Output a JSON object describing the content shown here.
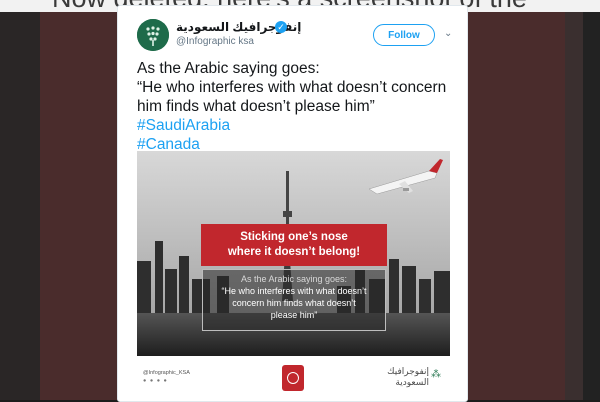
{
  "background": {
    "caption": "Now deleted, here's a screenshot of the"
  },
  "tweet": {
    "author_name": "إنفوجرافيك السعودية",
    "author_handle": "@Infographic ksa",
    "follow_label": "Follow",
    "text_lines": [
      "As the Arabic saying goes:",
      "“He who interferes with what doesn’t concern",
      "him finds what doesn’t please him”"
    ],
    "hashtags": [
      "#SaudiArabia",
      "#Canada"
    ],
    "image": {
      "banner_lines": [
        "Sticking one’s nose",
        "where it doesn’t belong!"
      ],
      "quote_heading": "As the Arabic saying goes:",
      "quote_lines": [
        "“He who interferes with what doesn’t",
        "concern him finds what doesn’t",
        "please him”"
      ],
      "footer_handle": "@Infographic_KSA",
      "footer_brand_lines": [
        "إنفوجرافيك",
        "السعودية"
      ]
    }
  },
  "colors": {
    "link": "#1da1f2",
    "banner": "#c1272d",
    "backdrop": "#4a2c2c"
  }
}
